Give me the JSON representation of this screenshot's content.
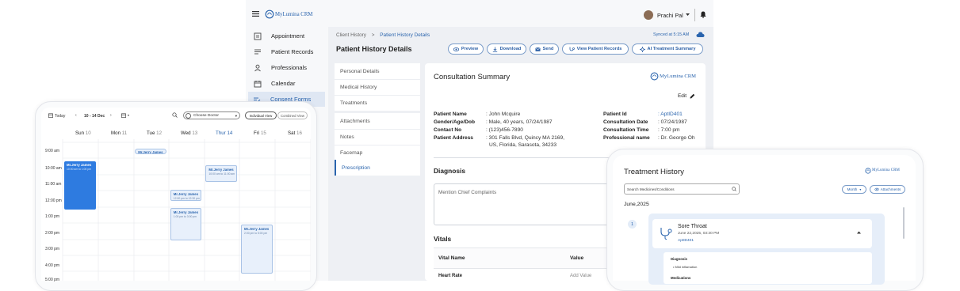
{
  "app": {
    "brand": "MyLumina CRM",
    "user_name": "Prachi Pal"
  },
  "sidebar": {
    "items": [
      {
        "label": "Appointment",
        "icon": "appointment-icon"
      },
      {
        "label": "Patient Records",
        "icon": "records-icon"
      },
      {
        "label": "Professionals",
        "icon": "person-icon"
      },
      {
        "label": "Calendar",
        "icon": "calendar-icon"
      },
      {
        "label": "Consent Forms",
        "icon": "consent-icon",
        "active": true
      }
    ]
  },
  "breadcrumb": {
    "parent": "Client History",
    "separator": ">",
    "current": "Patient History Details"
  },
  "sync_status": "Synced at 5:15 AM",
  "page_title": "Patient History Details",
  "actions": {
    "preview": "Preview",
    "download": "Download",
    "send": "Send",
    "view_records": "View Patient Records",
    "ai_summary": "AI Treatment Summary"
  },
  "tabs": [
    "Personal Details",
    "Medical History",
    "Treatments",
    "Attachments",
    "Notes",
    "Facemap",
    "Prescription"
  ],
  "active_tab": "Prescription",
  "consultation": {
    "title": "Consultation Summary",
    "brand": "MyLumina CRM",
    "edit": "Edit",
    "left_fields": [
      {
        "label": "Patient Name",
        "value": ": John Mcquire"
      },
      {
        "label": "Gender/Age/Dob",
        "value": ": Male, 40 years, 07/24/1987"
      },
      {
        "label": "Contact No",
        "value": ": (123)456-7890"
      },
      {
        "label": "Patient Address",
        "value": ": 301 Falls Blvd, Quincy MA  2169,",
        "value2": "US, Florida, Sarasota, 34233"
      }
    ],
    "right_fields": [
      {
        "label": "Patient Id",
        "value": ": AptID401"
      },
      {
        "label": "Consultation Date",
        "value": ": 07/24/1987"
      },
      {
        "label": "Consultation Time",
        "value": ": 7:00 pm"
      },
      {
        "label": "Professional name",
        "value": ": Dr. George Oh"
      }
    ],
    "diagnosis_title": "Diagnosis",
    "diagnosis_placeholder": "Mention Chief Complaints",
    "vitals_title": "Vitals",
    "vitals_headers": [
      "Vital Name",
      "Value"
    ],
    "vitals_rows": [
      {
        "name": "Heart Rate",
        "value": "Add Value"
      }
    ]
  },
  "calendar": {
    "today": "Today",
    "range": "10 - 14 Dec",
    "doctor_placeholder": "Choose Doctor",
    "individual_view": "Individual View",
    "combined_view": "Combined View",
    "days": [
      {
        "name": "Sun",
        "num": "10"
      },
      {
        "name": "Mon",
        "num": "11"
      },
      {
        "name": "Tue",
        "num": "12"
      },
      {
        "name": "Wed",
        "num": "13"
      },
      {
        "name": "Thur",
        "num": "14",
        "highlight": true
      },
      {
        "name": "Fri",
        "num": "15"
      },
      {
        "name": "Sat",
        "num": "16"
      }
    ],
    "times": [
      "9:00 am",
      "10:00 am",
      "11:00 am",
      "12:00 pm",
      "1:00 pm",
      "2:00 pm",
      "3:00 pm",
      "4:00 pm",
      "5:00 pm"
    ],
    "events": [
      {
        "title": "Mr.Jerry James",
        "sub": "",
        "day": 2,
        "start": 8.9,
        "end": 9.25,
        "style": "light"
      },
      {
        "title": "Mr.Jerry James",
        "sub": "10:00 am to 1:00 pm",
        "day": 0,
        "start": 9.7,
        "end": 12.65,
        "style": "dark"
      },
      {
        "title": "Mr.Jerry James",
        "sub": "10:00 am to 11:00 am",
        "day": 4,
        "start": 9.95,
        "end": 10.95,
        "style": "light"
      },
      {
        "title": "Mr.Jerry James",
        "sub": "12:00 pm to 12:30 pm",
        "day": 3,
        "start": 11.45,
        "end": 12.1,
        "style": "light"
      },
      {
        "title": "Mr.Jerry James",
        "sub": "1:00 pm to 3:00 pm",
        "day": 3,
        "start": 12.55,
        "end": 14.55,
        "style": "light"
      },
      {
        "title": "Mr.Jerry James",
        "sub": "2:00 pm to 5:00 pm",
        "day": 5,
        "start": 13.6,
        "end": 16.6,
        "style": "light"
      }
    ]
  },
  "treatment_history": {
    "title": "Treatment History",
    "brand": "MyLumina CRM",
    "search_placeholder": "Search Medicines/Conditions",
    "period": "Month",
    "attachments": "Attachments",
    "month_label": "June,2025",
    "entries": [
      {
        "index": "1",
        "condition": "Sore Throat",
        "date": "June 22,2025, 03:30 PM",
        "id": "AptID401",
        "sections": [
          {
            "title": "Diagnosis",
            "items": [
              "Mild inflamation"
            ]
          },
          {
            "title": "Medications",
            "items": []
          }
        ]
      }
    ]
  }
}
